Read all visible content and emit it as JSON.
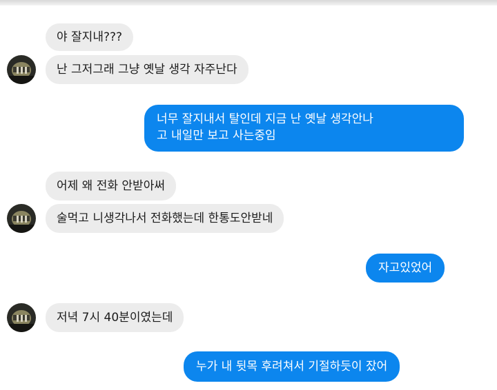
{
  "messages": [
    {
      "side": "in",
      "text": "야 잘지내???"
    },
    {
      "side": "in",
      "text": "난 그저그래 그냥 옛날 생각 자주난다"
    },
    {
      "side": "out",
      "text": "너무 잘지내서 탈인데 지금 난 옛날 생각안나\n고 내일만 보고 사는중임"
    },
    {
      "side": "in",
      "text": "어제 왜 전화 안받아써"
    },
    {
      "side": "in",
      "text": "술먹고 니생각나서 전화했는데 한통도안받네"
    },
    {
      "side": "out",
      "text": "자고있었어"
    },
    {
      "side": "in",
      "text": "저녁 7시 40분이였는데"
    },
    {
      "side": "out",
      "text": "누가 내 뒷목 후려쳐서 기절하듯이 잤어"
    }
  ],
  "avatar_icon": "contact-avatar",
  "colors": {
    "outgoing": "#0c86ee",
    "incoming": "#ececec"
  }
}
